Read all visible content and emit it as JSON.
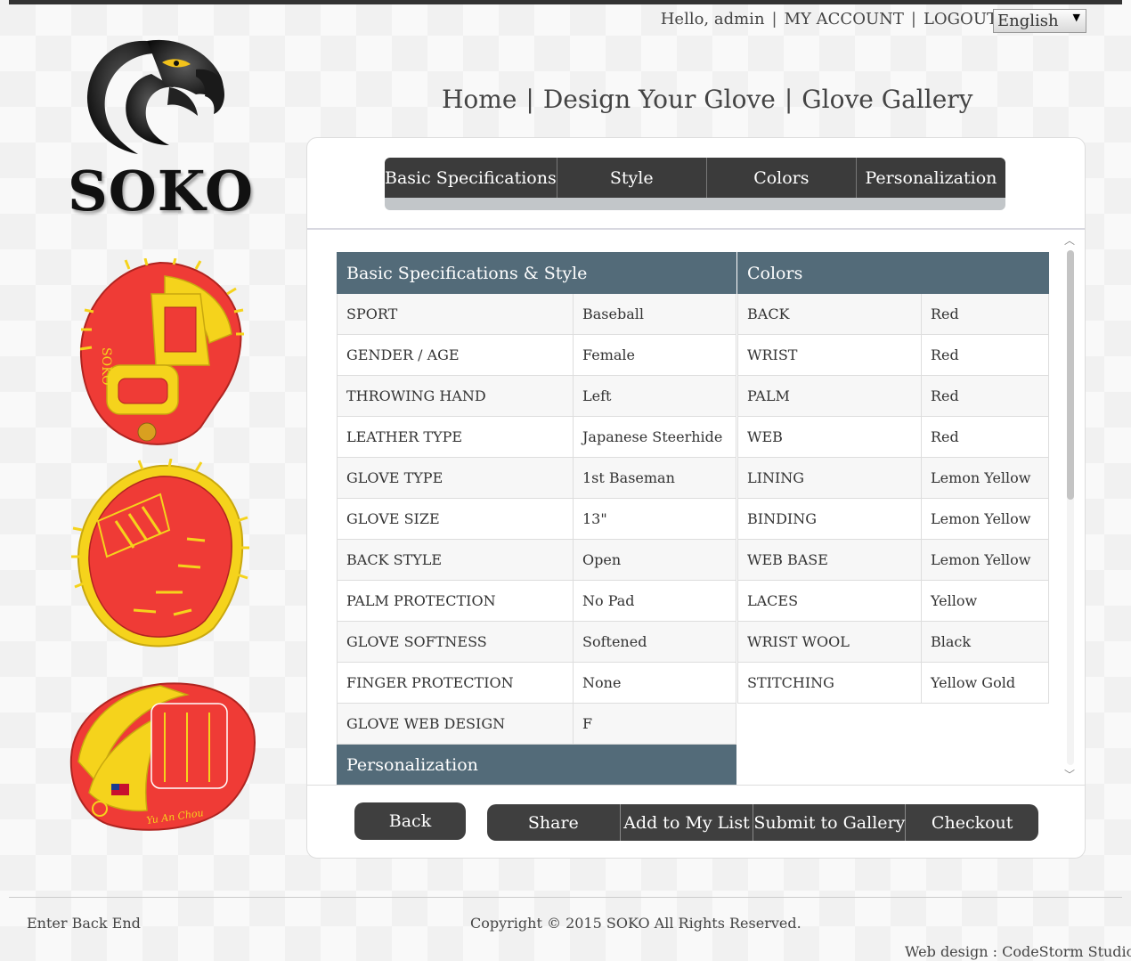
{
  "header": {
    "greeting": "Hello, admin",
    "sep": "|",
    "my_account": "MY ACCOUNT",
    "logout": "LOGOUT",
    "language": "English",
    "lang_arrow": "▼"
  },
  "logo": {
    "brand": "SOKO"
  },
  "nav": {
    "home": "Home",
    "design": "Design Your Glove",
    "gallery": "Glove Gallery",
    "sep": "|"
  },
  "steps": [
    "Basic Specifications",
    "Style",
    "Colors",
    "Personalization"
  ],
  "specs": {
    "title": "Basic Specifications & Style",
    "rows": [
      {
        "k": "SPORT",
        "v": "Baseball"
      },
      {
        "k": "GENDER / AGE",
        "v": "Female"
      },
      {
        "k": "THROWING HAND",
        "v": "Left"
      },
      {
        "k": "LEATHER TYPE",
        "v": "Japanese Steerhide"
      },
      {
        "k": "GLOVE TYPE",
        "v": "1st Baseman"
      },
      {
        "k": "GLOVE SIZE",
        "v": "13\""
      },
      {
        "k": "BACK STYLE",
        "v": "Open"
      },
      {
        "k": "PALM PROTECTION",
        "v": "No Pad"
      },
      {
        "k": "GLOVE SOFTNESS",
        "v": "Softened"
      },
      {
        "k": "FINGER PROTECTION",
        "v": "None"
      },
      {
        "k": "GLOVE WEB DESIGN",
        "v": "F"
      }
    ],
    "personalization_title": "Personalization"
  },
  "colors": {
    "title": "Colors",
    "rows": [
      {
        "k": "BACK",
        "v": "Red"
      },
      {
        "k": "WRIST",
        "v": "Red"
      },
      {
        "k": "PALM",
        "v": "Red"
      },
      {
        "k": "WEB",
        "v": "Red"
      },
      {
        "k": "LINING",
        "v": "Lemon Yellow"
      },
      {
        "k": "BINDING",
        "v": "Lemon Yellow"
      },
      {
        "k": "WEB BASE",
        "v": "Lemon Yellow"
      },
      {
        "k": "LACES",
        "v": "Yellow"
      },
      {
        "k": "WRIST WOOL",
        "v": "Black"
      },
      {
        "k": "STITCHING",
        "v": "Yellow Gold"
      }
    ]
  },
  "buttons": {
    "back": "Back",
    "share": "Share",
    "add": "Add to My List",
    "submit": "Submit to Gallery",
    "checkout": "Checkout"
  },
  "footer": {
    "left": "Enter Back End",
    "center": "Copyright © 2015 SOKO All Rights Reserved.",
    "right": "Web design : CodeStorm Studio"
  },
  "glove_images": {
    "glove_label": "SOKO",
    "signature": "Yu An Chou"
  },
  "theme": {
    "glove_red": "#ef3b36",
    "glove_yellow": "#f5d31c",
    "header_bg": "#536b79",
    "button_bg": "#3f3f3f"
  }
}
